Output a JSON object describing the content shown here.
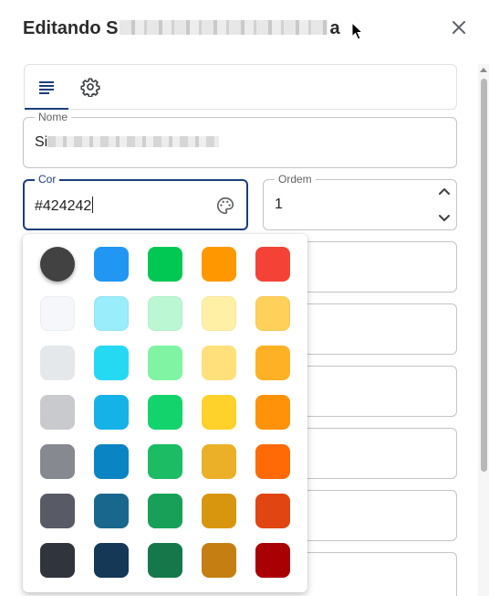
{
  "dialog": {
    "title_prefix": "Editando S",
    "title_suffix": "a",
    "close_icon": "close-icon"
  },
  "tabs": [
    {
      "icon": "text-lines-icon",
      "active": true
    },
    {
      "icon": "gear-icon",
      "active": false
    }
  ],
  "fields": {
    "nome": {
      "label": "Nome",
      "value_prefix": "Si"
    },
    "cor": {
      "label": "Cor",
      "value": "#424242",
      "icon": "palette-icon"
    },
    "ordem": {
      "label": "Ordem",
      "value": "1"
    }
  },
  "palette": {
    "selected": "#424242",
    "rows": [
      [
        "#424242",
        "#2196f3",
        "#00c853",
        "#ff9800",
        "#f44336"
      ],
      [
        "#f5f7fa",
        "#9aedfa",
        "#bcf7d3",
        "#fff0a6",
        "#ffd15b"
      ],
      [
        "#e5e8eb",
        "#26d9f2",
        "#80f4a3",
        "#ffe07a",
        "#ffb125"
      ],
      [
        "#c8cace",
        "#15b2e8",
        "#13d46c",
        "#ffd12a",
        "#ff9208"
      ],
      [
        "#878991",
        "#0b84c4",
        "#1cbc64",
        "#ebb028",
        "#ff6a06"
      ],
      [
        "#585b66",
        "#19678d",
        "#18a058",
        "#d8960f",
        "#e04512"
      ],
      [
        "#30343c",
        "#143855",
        "#14784a",
        "#c47e12",
        "#a90004"
      ]
    ]
  }
}
